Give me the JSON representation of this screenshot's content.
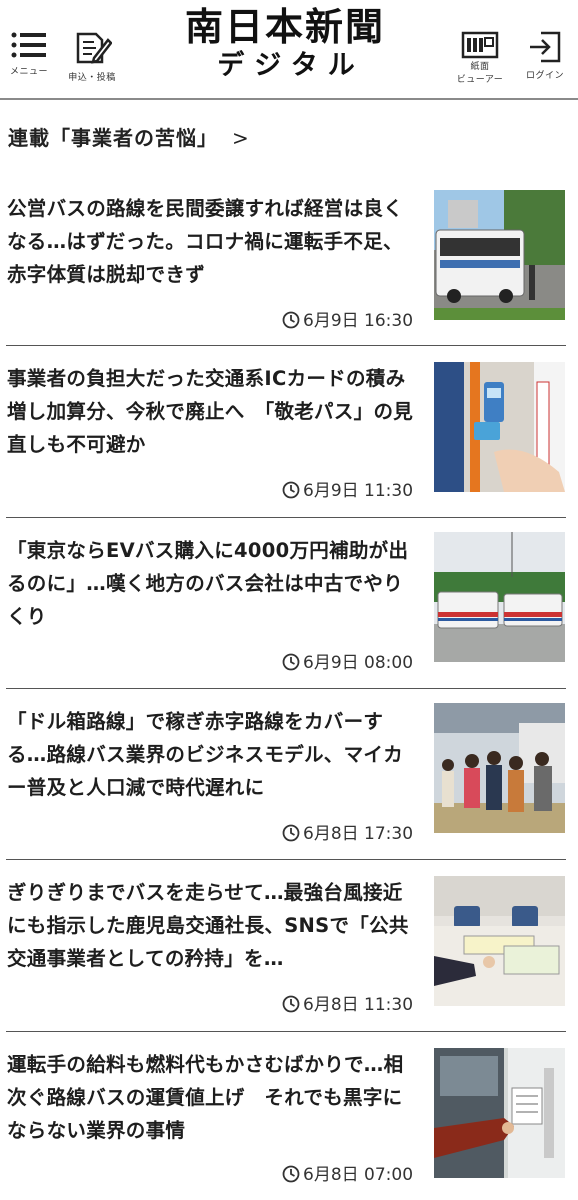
{
  "header": {
    "logo_main": "南日本新聞",
    "logo_sub": "デジタル",
    "menu_label": "メニュー",
    "post_label": "申込・投稿",
    "viewer_label_1": "紙面",
    "viewer_label_2": "ビューアー",
    "login_label": "ログイン"
  },
  "section": {
    "title": "連載「事業者の苦悩」",
    "arrow": ">"
  },
  "articles": [
    {
      "title": "公営バスの路線を民間委譲すれば経営は良くなる…はずだった。コロナ禍に運転手不足、赤字体質は脱却できず",
      "time": "6月9日 16:30"
    },
    {
      "title": "事業者の負担大だった交通系ICカードの積み増し加算分、今秋で廃止へ　「敬老パス」の見直しも不可避か",
      "time": "6月9日 11:30"
    },
    {
      "title": "「東京ならEVバス購入に4000万円補助が出るのに」…嘆く地方のバス会社は中古でやりくり",
      "time": "6月9日 08:00"
    },
    {
      "title": "「ドル箱路線」で稼ぎ赤字路線をカバーする…路線バス業界のビジネスモデル、マイカー普及と人口減で時代遅れに",
      "time": "6月8日 17:30"
    },
    {
      "title": "ぎりぎりまでバスを走らせて…最強台風接近にも指示した鹿児島交通社長、SNSで「公共交通事業者としての矜持」を…",
      "time": "6月8日 11:30"
    },
    {
      "title": "運転手の給料も燃料代もかさむばかりで…相次ぐ路線バスの運賃値上げ　それでも黒字にならない業界の事情",
      "time": "6月8日 07:00"
    }
  ]
}
